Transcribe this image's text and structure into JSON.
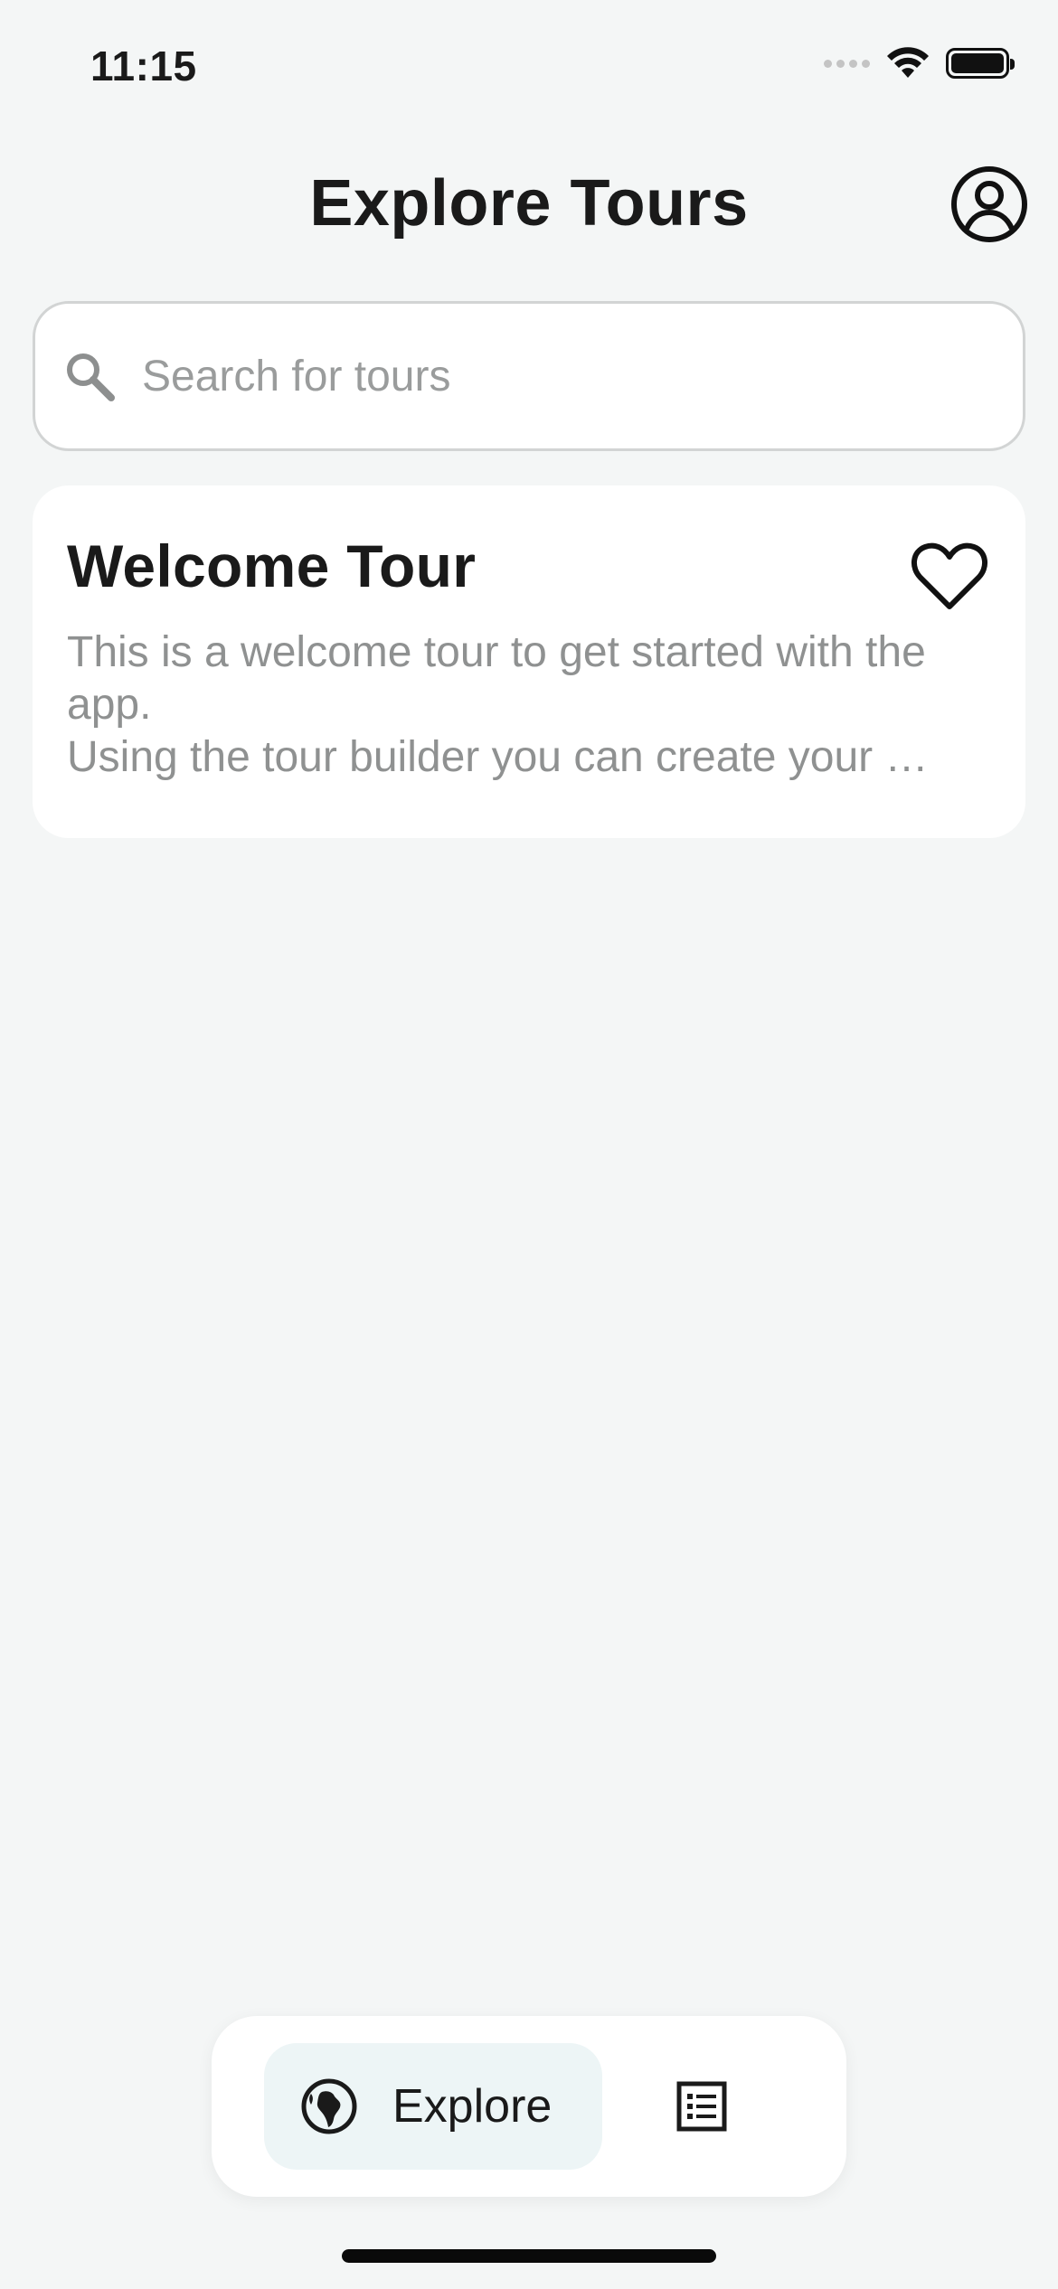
{
  "status_bar": {
    "time": "11:15",
    "icons": [
      "cellular-signal-icon",
      "wifi-icon",
      "battery-icon"
    ]
  },
  "header": {
    "title": "Explore Tours",
    "profile_icon": "account-circle-icon"
  },
  "search": {
    "placeholder": "Search for tours",
    "value": "",
    "icon": "search-icon"
  },
  "tours": [
    {
      "title": "Welcome Tour",
      "description": "This is a welcome tour to get started with the app.\nUsing the tour builder you can create your …",
      "favorite_icon": "heart-outline-icon"
    }
  ],
  "bottom_nav": {
    "items": [
      {
        "label": "Explore",
        "icon": "globe-icon",
        "active": true
      },
      {
        "label": "",
        "icon": "list-icon",
        "active": false
      }
    ]
  },
  "colors": {
    "background": "#f4f6f6",
    "card": "#ffffff",
    "active_nav": "#edf5f6",
    "text_primary": "#1a1a1a",
    "text_secondary": "#8f9191"
  }
}
